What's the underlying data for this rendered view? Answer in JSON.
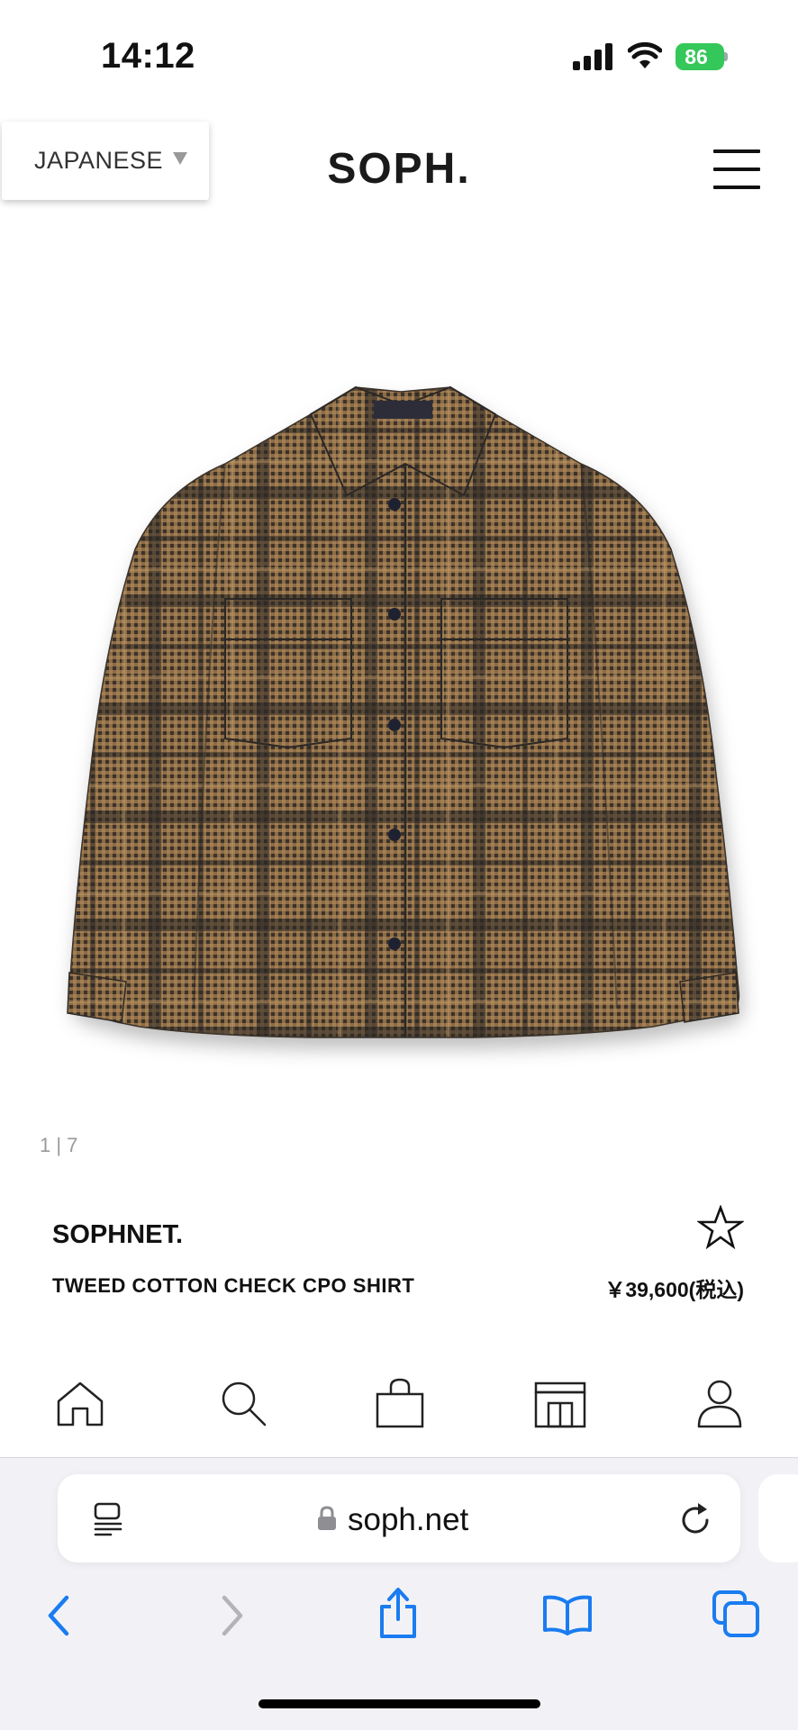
{
  "status_bar": {
    "time": "14:12",
    "battery": "86"
  },
  "header": {
    "language_selector": "JAPANESE",
    "logo": "SOPH.",
    "menu_icon": "hamburger-menu-icon"
  },
  "gallery": {
    "counter": "1 | 7"
  },
  "product": {
    "brand": "SOPHNET.",
    "name": "TWEED COTTON CHECK CPO SHIRT",
    "price": "￥39,600(税込)",
    "favorite_icon": "star-outline-icon"
  },
  "bottom_nav": {
    "items": [
      {
        "icon": "home-icon"
      },
      {
        "icon": "search-icon"
      },
      {
        "icon": "shopping-bag-icon"
      },
      {
        "icon": "store-icon"
      },
      {
        "icon": "account-icon"
      }
    ]
  },
  "browser": {
    "url": "soph.net",
    "toolbar": [
      "back-icon",
      "forward-icon",
      "share-icon",
      "bookmarks-icon",
      "tabs-icon"
    ]
  },
  "colors": {
    "battery": "#34c759",
    "safari_blue": "#1a7cf0",
    "shirt_brown": "#8a6a45",
    "shirt_check": "#2d2a2a"
  }
}
